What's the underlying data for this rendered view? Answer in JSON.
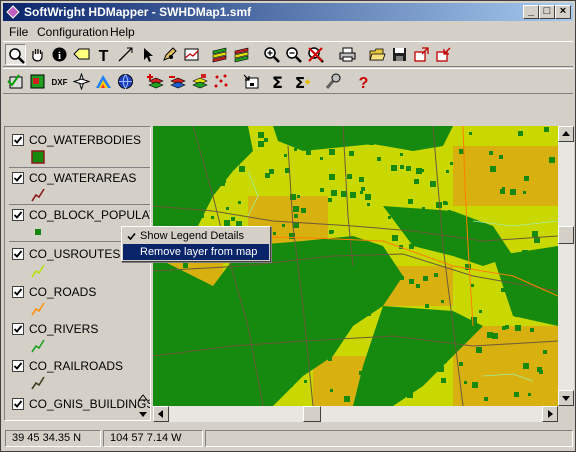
{
  "window": {
    "title": "SoftWright HDMapper - SWHDMap1.smf"
  },
  "menu": [
    "File",
    "Configuration",
    "Help"
  ],
  "toolbar1": [
    {
      "name": "zoom-tool-icon"
    },
    {
      "name": "pan-hand-icon"
    },
    {
      "name": "info-icon"
    },
    {
      "name": "label-tool-icon"
    },
    {
      "name": "text-tool-icon"
    },
    {
      "name": "line-tool-icon"
    },
    {
      "name": "select-arrow-icon"
    },
    {
      "name": "pencil-icon"
    },
    {
      "name": "area-tool-icon"
    },
    {
      "name": "layers-green-icon"
    },
    {
      "name": "layers-red-icon"
    },
    {
      "name": "zoom-in-icon"
    },
    {
      "name": "zoom-out-icon"
    },
    {
      "name": "zoom-reset-icon"
    },
    {
      "name": "print-icon"
    },
    {
      "name": "open-folder-icon"
    },
    {
      "name": "save-icon"
    },
    {
      "name": "export-icon"
    },
    {
      "name": "import-icon"
    }
  ],
  "toolbar2": [
    {
      "name": "check-layer-icon"
    },
    {
      "name": "map-layer-icon"
    },
    {
      "name": "dxf-icon",
      "text": "DXF"
    },
    {
      "name": "compass-icon"
    },
    {
      "name": "color-palette-icon"
    },
    {
      "name": "globe-icon"
    },
    {
      "name": "add-layer-icon"
    },
    {
      "name": "remove-layer-icon"
    },
    {
      "name": "layer-properties-icon"
    },
    {
      "name": "points-icon"
    },
    {
      "name": "layer-order-icon"
    },
    {
      "name": "sum-icon",
      "text": "Σ"
    },
    {
      "name": "sum-plus-icon",
      "text": "Σ"
    },
    {
      "name": "wrench-icon"
    },
    {
      "name": "help-icon",
      "text": "?"
    }
  ],
  "legend": {
    "layers": [
      {
        "name": "CO_WATERBODIES"
      },
      {
        "name": "CO_WATERAREAS"
      },
      {
        "name": "CO_BLOCK_POPULATION"
      },
      {
        "name": "CO_USROUTES"
      },
      {
        "name": "CO_ROADS"
      },
      {
        "name": "CO_RIVERS"
      },
      {
        "name": "CO_RAILROADS"
      },
      {
        "name": "CO_GNIS_BUILDINGS"
      }
    ]
  },
  "context_menu": {
    "items": [
      {
        "label": "Show Legend Details",
        "checked": true
      },
      {
        "label": "Remove layer from map",
        "checked": false
      }
    ]
  },
  "status": {
    "lat": "39 45 34.35 N",
    "lon": "104 57 7.14 W"
  },
  "colors": {
    "title_start": "#0a246a",
    "title_end": "#a6caf0",
    "map_dark_green": "#158a0e",
    "map_yellow": "#c9d800",
    "map_orange": "#d8b010",
    "roads": "#6a5a3a",
    "routes": "#ff7f00",
    "highlight": "#0a246a"
  }
}
